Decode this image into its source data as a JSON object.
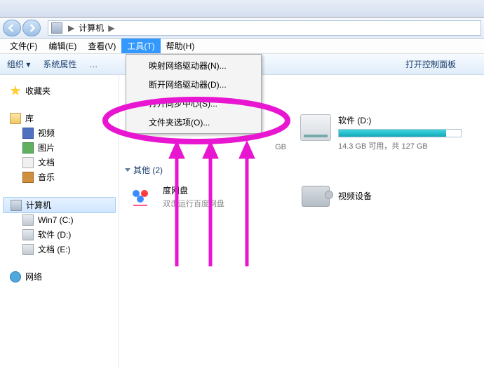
{
  "titlebar": {
    "title": ""
  },
  "breadcrumb": {
    "seg1": "计算机",
    "sep": "▶"
  },
  "menubar": {
    "file": "文件(F)",
    "edit": "编辑(E)",
    "view": "查看(V)",
    "tools": "工具(T)",
    "help": "帮助(H)"
  },
  "toolbar": {
    "org": "组织 ▾",
    "sysprop": "系统属性",
    "ellipsis": "…",
    "ctrl": "打开控制面板"
  },
  "sidebar": {
    "favorites": "收藏夹",
    "library": "库",
    "video": "视频",
    "pictures": "图片",
    "documents": "文档",
    "music": "音乐",
    "computer": "计算机",
    "c": "Win7 (C:)",
    "d": "软件 (D:)",
    "e": "文档 (E:)",
    "network": "网络"
  },
  "drives": [
    {
      "name": "软件 (D:)",
      "free": "14.3 GB 可用，共 127 GB",
      "fill": 88
    }
  ],
  "partial_free": "GB",
  "section_other": "其他 (2)",
  "items": {
    "baidu": {
      "name": "度网盘",
      "sub": "双击运行百度网盘"
    },
    "video": {
      "name": "视频设备"
    }
  },
  "dropdown": {
    "map": "映射网络驱动器(N)...",
    "disconnect": "断开网络驱动器(D)...",
    "sync": "打开同步中心(S)...",
    "folder_options": "文件夹选项(O)..."
  },
  "annotation": {
    "highlight_color": "#e815d1"
  }
}
